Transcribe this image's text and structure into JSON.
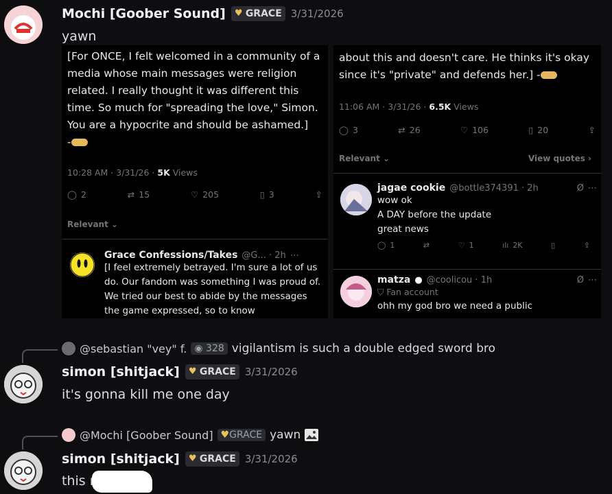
{
  "post1": {
    "author": "Mochi [Goober Sound]",
    "tag": "GRACE",
    "timestamp": "3/31/2026",
    "message": "yawn"
  },
  "tweet_left": {
    "text": "[For ONCE, I felt welcomed in a community of a media whose main messages were religion related. I really thought it was different this time. So much for \"spreading the love,\" Simon. You are a hypocrite and should be ashamed.]",
    "tail": "-",
    "meta_time": "10:28 AM · 3/31/26 · ",
    "meta_views": "5K",
    "meta_views_label": " Views",
    "replies": "2",
    "reposts": "15",
    "likes": "205",
    "bookmarks": "3",
    "relevant": "Relevant",
    "reply_name": "Grace Confessions/Takes",
    "reply_handle": "@G... · 2h",
    "reply_text": "[I feel extremely betrayed. I'm sure a lot of us do. Our fandom was something I was proud of. We tried our best to abide by the messages the game expressed, so to know"
  },
  "tweet_right": {
    "text": "about this and doesn't care. He thinks it's okay since it's \"private\" and defends her.] -",
    "meta_time": "11:06 AM · 3/31/26 · ",
    "meta_views": "6.5K",
    "meta_views_label": " Views",
    "replies": "3",
    "reposts": "26",
    "likes": "106",
    "bookmarks": "20",
    "relevant": "Relevant",
    "view_quotes": "View quotes",
    "reply1_name": "jagae cookie",
    "reply1_handle": "@bottle374391 · 2h",
    "reply1_lines": [
      "wow ok",
      "A DAY before the update",
      "great news"
    ],
    "reply1_replies": "1",
    "reply1_likes": "1",
    "reply1_views": "2K",
    "reply2_name": "matza",
    "reply2_handle": "@coolicou · 1h",
    "reply2_badge": "Fan account",
    "reply2_text": "ohh my god bro we need a public"
  },
  "reply_ref1": {
    "author": "@sebastian \"vey\" f.",
    "pill": "328",
    "text": "vigilantism is such a double edged sword bro"
  },
  "post2": {
    "author": "simon [shitjack]",
    "tag": "GRACE",
    "timestamp": "3/31/2026",
    "message": "it's gonna kill me one day"
  },
  "reply_ref2": {
    "author": "@Mochi [Goober Sound]",
    "tag": "GRACE",
    "text": "yawn"
  },
  "post3": {
    "author": "simon [shitjack]",
    "tag": "GRACE",
    "timestamp": "3/31/2026",
    "message": "this r"
  },
  "colors": {
    "background": "#0e0e11",
    "tag_heart": "#e8c35a",
    "tweet_bg": "#000000"
  }
}
